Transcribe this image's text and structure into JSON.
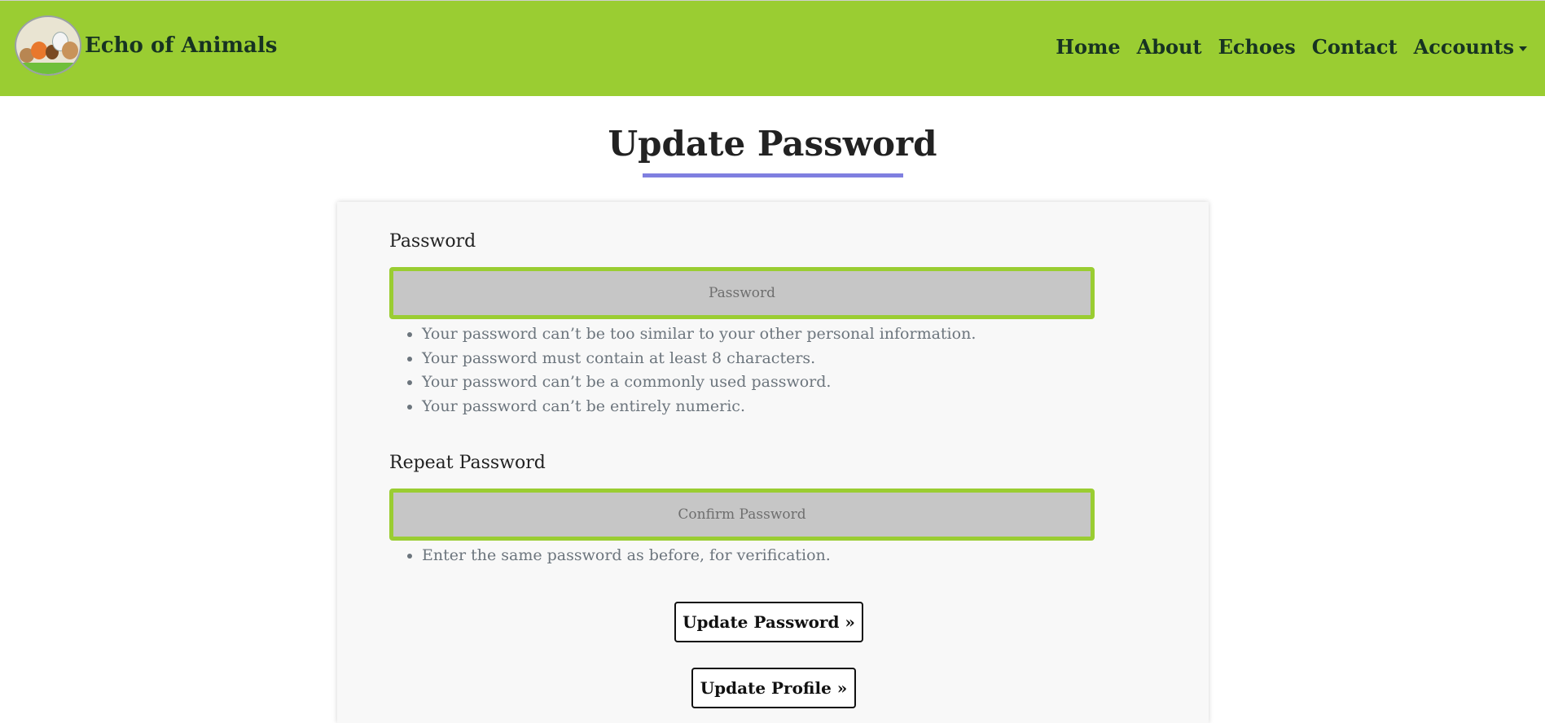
{
  "navbar": {
    "brand": "Echo of Animals",
    "logo_icon": "animals-logo-icon",
    "links": [
      "Home",
      "About",
      "Echoes",
      "Contact",
      "Accounts"
    ],
    "background": "#9acd32"
  },
  "page": {
    "title": "Update Password",
    "underline_color": "#7f7fe0"
  },
  "form": {
    "password_label": "Password",
    "password_placeholder": "Password",
    "password_help": [
      "Your password can’t be too similar to your other personal information.",
      "Your password must contain at least 8 characters.",
      "Your password can’t be a commonly used password.",
      "Your password can’t be entirely numeric."
    ],
    "repeat_label": "Repeat Password",
    "repeat_placeholder": "Confirm Password",
    "repeat_help": [
      "Enter the same password as before, for verification."
    ],
    "field_border_color": "#9acd32",
    "update_password_button": "Update Password »",
    "update_profile_button": "Update Profile »"
  }
}
